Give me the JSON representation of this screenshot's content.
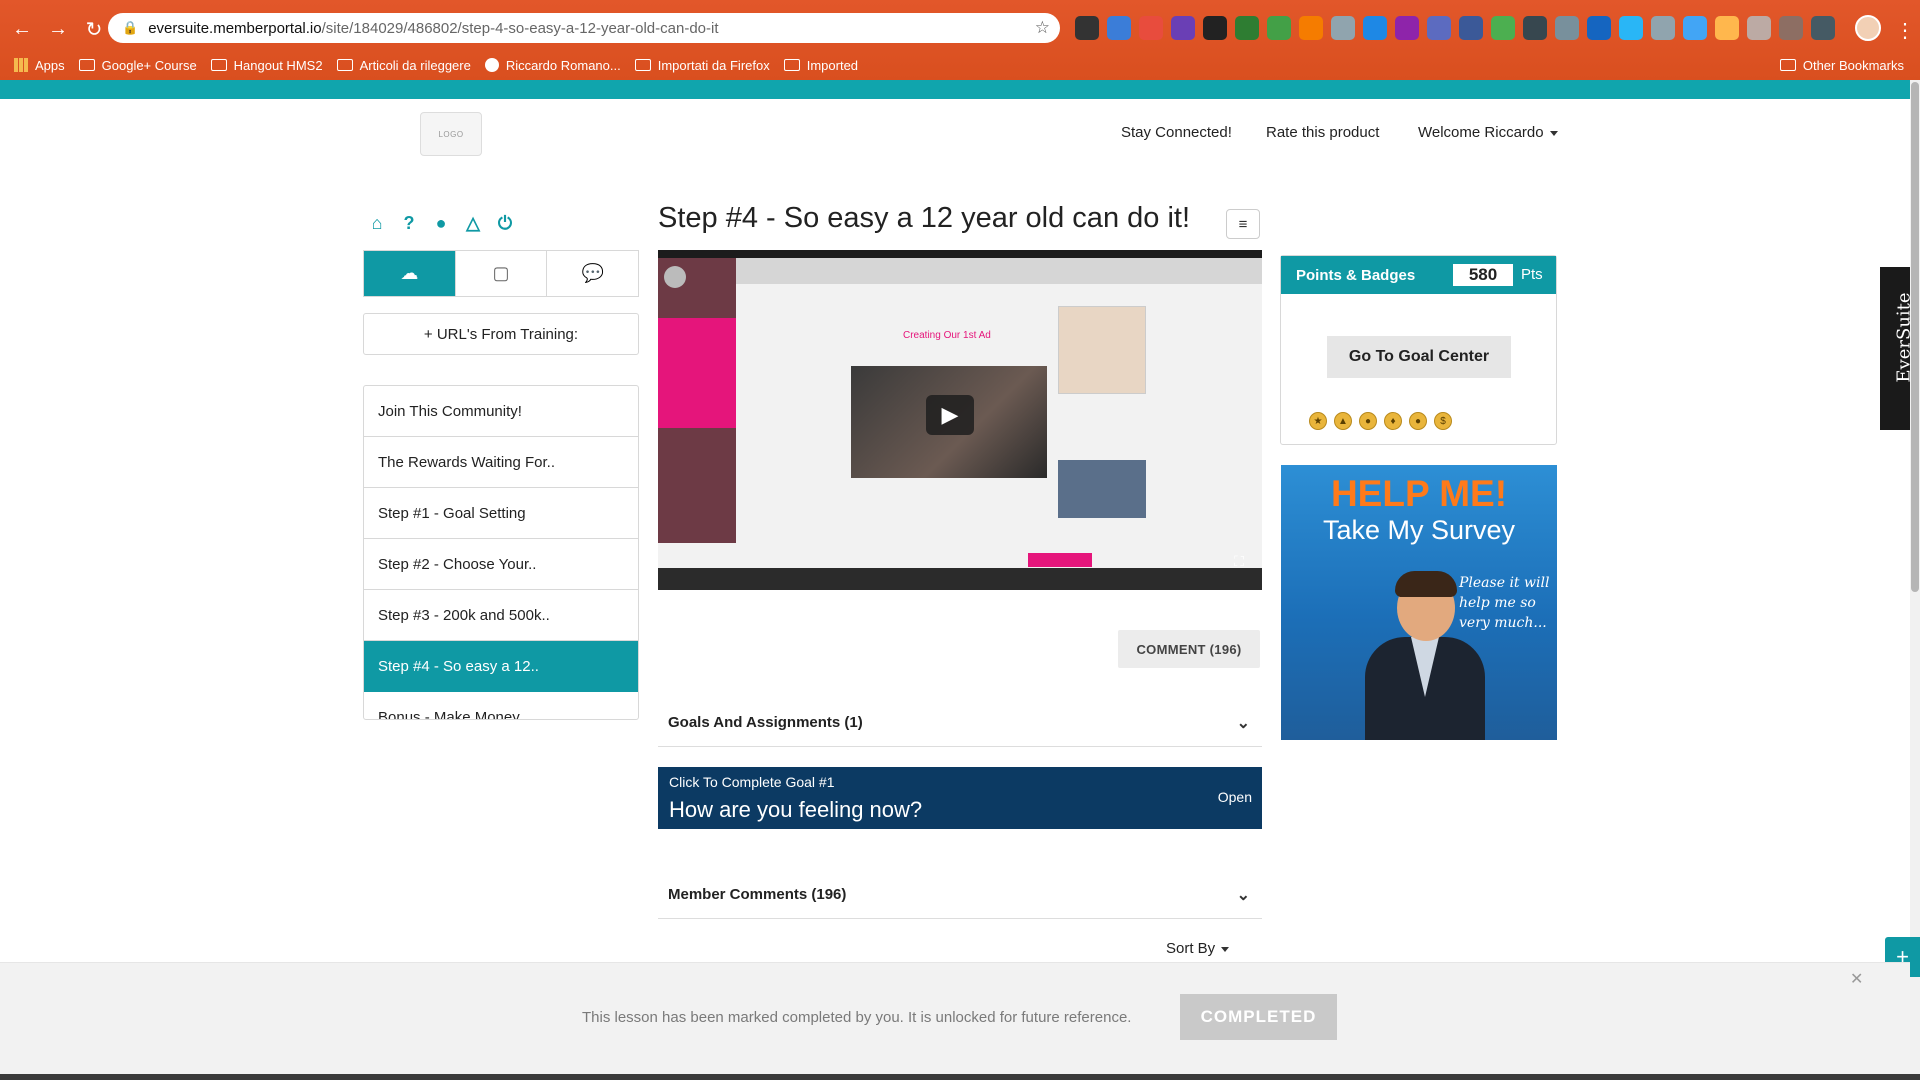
{
  "browser": {
    "url_host": "eversuite.memberportal.io",
    "url_path": "/site/184029/486802/step-4-so-easy-a-12-year-old-can-do-it",
    "bookmarks": [
      "Apps",
      "Google+ Course",
      "Hangout HMS2",
      "Articoli da rileggere",
      "Riccardo Romano...",
      "Importati da Firefox",
      "Imported"
    ],
    "other_bookmarks": "Other Bookmarks"
  },
  "header": {
    "nav": [
      "Stay Connected!",
      "Rate this product",
      "Welcome Riccardo"
    ]
  },
  "sidebar": {
    "url_training": "+ URL's From Training:",
    "lessons": [
      "Join This Community!",
      "The Rewards Waiting For..",
      "Step #1 - Goal Setting",
      "Step #2 - Choose Your..",
      "Step #3 - 200k and 500k..",
      "Step #4 - So easy a 12..",
      "Bonus - Make Money..."
    ],
    "active_index": 5
  },
  "main": {
    "title": "Step #4 - So easy a 12 year old can do it!",
    "video": {
      "inner_title": "Creating Our 1st Ad"
    },
    "comment_button": "COMMENT (196)",
    "goals_accordion": "Goals And Assignments (1)",
    "goal": {
      "label": "Click To Complete Goal #1",
      "question": "How are you feeling now?",
      "status": "Open"
    },
    "comments_accordion": "Member Comments (196)",
    "sort_by": "Sort By"
  },
  "right": {
    "points_title": "Points & Badges",
    "points_value": "580",
    "points_unit": "Pts",
    "goal_center_button": "Go To Goal Center",
    "survey": {
      "headline": "HELP ME!",
      "subhead": "Take My Survey",
      "note": "Please it will help me so very much..."
    },
    "eversuite_tab": "EverSuite"
  },
  "completion": {
    "message": "This lesson has been marked completed by you. It is unlocked for future reference.",
    "button": "COMPLETED"
  },
  "colors": {
    "accent": "#0f99a4",
    "goal_bg": "#0c3a63",
    "chrome": "#d94f1f",
    "survey_orange": "#ff7a1a"
  }
}
